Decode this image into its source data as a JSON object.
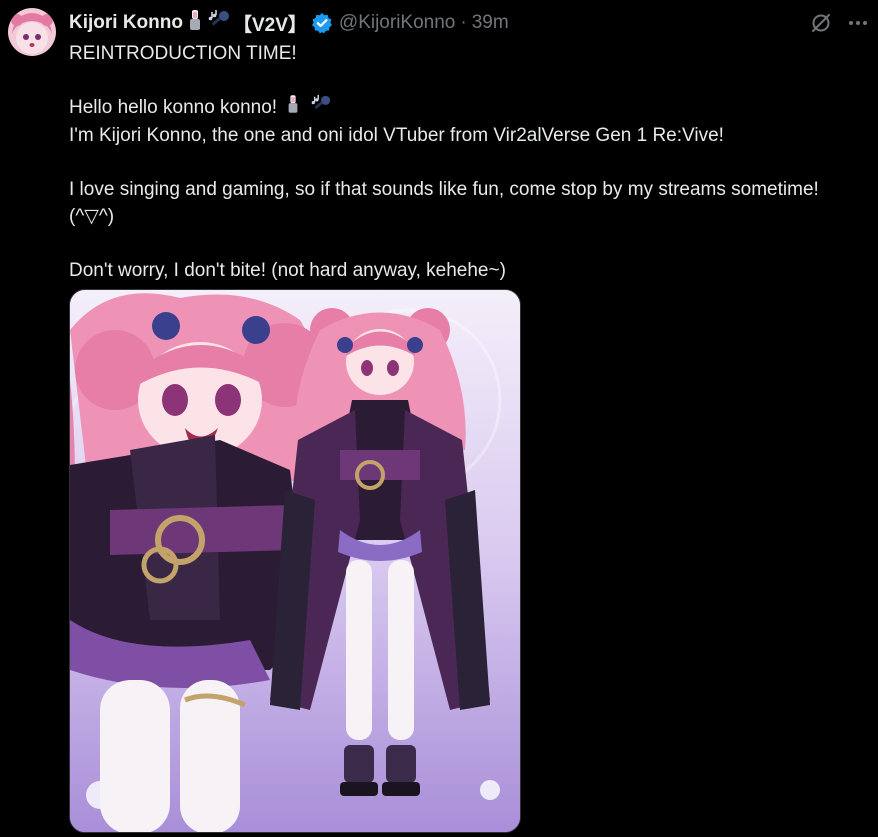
{
  "post": {
    "author": {
      "display_name": "Kijori Konno",
      "name_tag": "【V2V】",
      "handle": "@KijoriKonno",
      "separator": "·",
      "timestamp": "39m",
      "name_emojis": [
        "lipstick-icon",
        "microphone-notes-icon"
      ],
      "verified_icon": "verified-badge-icon"
    },
    "text_lines": [
      "REINTRODUCTION TIME!",
      "",
      "Hello hello konno konno!",
      "I'm Kijori Konno, the one and oni idol VTuber from Vir2alVerse Gen 1 Re:Vive!",
      "",
      "I love singing and gaming, so if that sounds like fun, come stop by my streams sometime!",
      "(^▽^)",
      "",
      "Don't worry, I don't bite! (not hard anyway, kehehe~)"
    ],
    "top_actions": [
      "grok-icon",
      "more-options-icon"
    ]
  },
  "colors": {
    "background": "#000000",
    "text_primary": "#e7e9ea",
    "text_secondary": "#71767b",
    "verified_blue": "#1d9bf0"
  }
}
